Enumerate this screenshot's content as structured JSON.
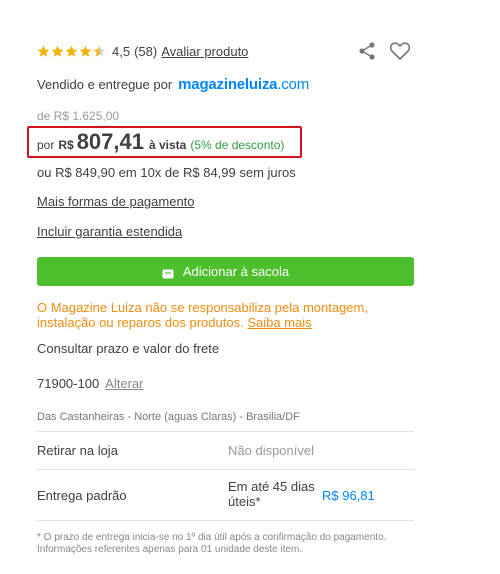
{
  "rating": {
    "value": "4,5",
    "stars": 4.5,
    "count": "(58)",
    "review_link": "Avaliar produto"
  },
  "actions": {
    "share_icon": "share-icon",
    "wishlist_icon": "heart-icon"
  },
  "seller": {
    "text": "Vendido e entregue por",
    "brand": "magazineluiza",
    "brand_suffix": ".com",
    "brand_color": "#0086ff"
  },
  "price": {
    "old": "de R$ 1.625,00",
    "por": "por",
    "currency": "R$",
    "value": "807,41",
    "payment": "à vista",
    "discount": "(5% de desconto)",
    "installments": "ou R$ 849,90 em 10x de R$ 84,99 sem juros",
    "highlight_color": "#d4121c",
    "discount_color": "#2e9e3a"
  },
  "links": {
    "more_payment": "Mais formas de pagamento",
    "warranty": "Incluir garantia estendida"
  },
  "cart": {
    "add_label": "Adicionar à sacola",
    "icon": "bag-icon",
    "button_color": "#4dbf2c"
  },
  "notice": {
    "text": "O Magazine Luiza não se responsabiliza pela montagem, instalação ou reparos dos produtos.",
    "link": "Saiba mais",
    "color": "#f08c11"
  },
  "freight": {
    "title": "Consultar prazo e valor do frete",
    "cep": "71900-100",
    "change_link": "Alterar",
    "address": "Das Castanheiras - Norte (aguas Claras) - Brasilia/DF",
    "options": [
      {
        "label": "Retirar na loja",
        "status": "Não disponível"
      },
      {
        "label": "Entrega padrão",
        "time": "Em até 45 dias úteis*",
        "price": "R$ 96,81"
      }
    ],
    "footnote": "* O prazo de entrega inicia-se no 1º dia útil após a confirmação do pagamento. Informações referentes apenas para 01 unidade deste item."
  }
}
